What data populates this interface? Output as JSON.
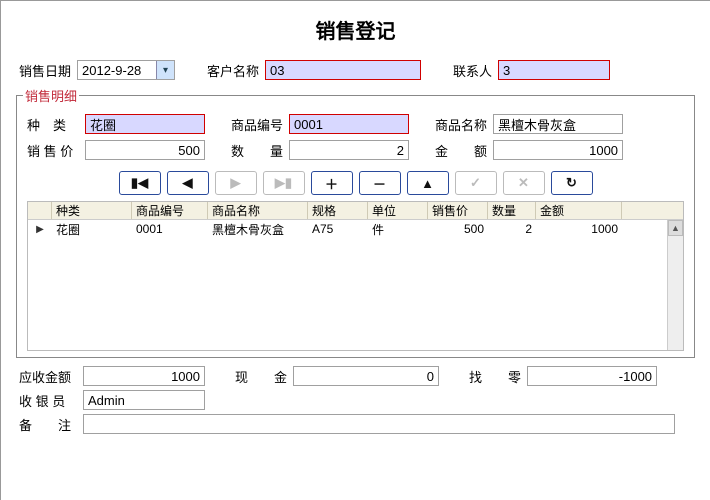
{
  "title": "销售登记",
  "header": {
    "sale_date_label": "销售日期",
    "sale_date_value": "2012-9-28",
    "customer_label": "客户名称",
    "customer_value": "03",
    "contact_label": "联系人",
    "contact_value": "3"
  },
  "detail": {
    "legend": "销售明细",
    "category_label": "种　类",
    "category_value": "花圈",
    "code_label": "商品编号",
    "code_value": "0001",
    "name_label": "商品名称",
    "name_value": "黑檀木骨灰盒",
    "price_label": "销 售 价",
    "price_value": "500",
    "qty_label": "数　　量",
    "qty_value": "2",
    "amount_label": "金　　额",
    "amount_value": "1000"
  },
  "grid": {
    "headers": {
      "category": "种类",
      "code": "商品编号",
      "name": "商品名称",
      "spec": "规格",
      "unit": "单位",
      "price": "销售价",
      "qty": "数量",
      "amount": "金额"
    },
    "rows": [
      {
        "category": "花圈",
        "code": "0001",
        "name": "黑檀木骨灰盒",
        "spec": "A75",
        "unit": "件",
        "price": "500",
        "qty": "2",
        "amount": "1000"
      }
    ]
  },
  "footer": {
    "due_label": "应收金额",
    "due_value": "1000",
    "cash_label": "现　　金",
    "cash_value": "0",
    "change_label": "找　　零",
    "change_value": "-1000",
    "cashier_label": "收 银 员",
    "cashier_value": "Admin",
    "remark_label": "备　　注",
    "remark_value": ""
  },
  "nav_icons": {
    "first": "▮◀",
    "prev": "◀",
    "next": "▶",
    "last": "▶▮",
    "add": "＋",
    "del": "－",
    "up": "▲",
    "check": "✓",
    "cancel": "✕",
    "refresh": "↻"
  }
}
